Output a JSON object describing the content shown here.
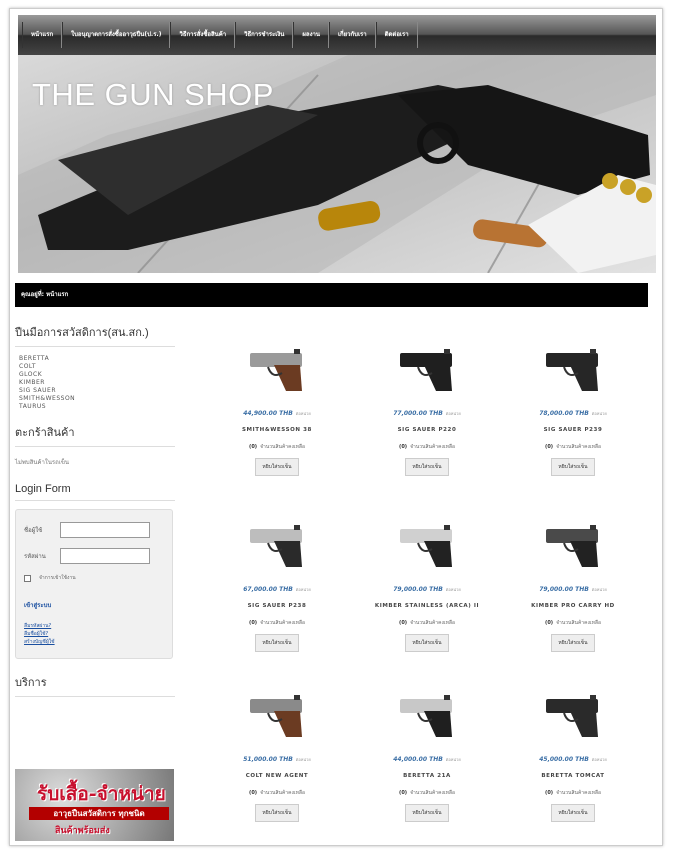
{
  "nav": {
    "items": [
      "หน้าแรก",
      "ใบอนุญาตการสั่งซื้ออาวุธปืน(ป.ร.)",
      "วิธีการสั่งซื้อสินค้า",
      "วิธีการชำระเงิน",
      "ผลงาน",
      "เกี่ยวกับเรา",
      "ติดต่อเรา"
    ]
  },
  "banner": {
    "title": "THE GUN SHOP"
  },
  "breadcrumb": {
    "text": "คุณอยู่ที่: หน้าแรก"
  },
  "sidebar": {
    "categories_title": "ปืนมือการสวัสดิการ(สน.สก.)",
    "categories": [
      "BERETTA",
      "COLT",
      "GLOCK",
      "KIMBER",
      "SIG SAUER",
      "SMITH&WESSON",
      "TAURUS"
    ],
    "cart_title": "ตะกร้าสินค้า",
    "cart_empty": "ไม่พบสินค้าในรถเข็น",
    "login_title": "Login Form",
    "username_label": "ชื่อผู้ใช้",
    "password_label": "รหัสผ่าน",
    "remember_label": "จำการเข้าใช้งาน",
    "login_button": "เข้าสู่ระบบ",
    "links": [
      "ลืมรหัสผ่าน?",
      "ลืมชื่อผู้ใช้?",
      "สร้างบัญชีผู้ใช้"
    ],
    "ad_title": "บริการ",
    "ad_text_1": "รับเสื้อ-จำหน่าย",
    "ad_text_2": "อาวุธปืนสวัสดิการ ทุกชนิด",
    "ad_text_3": "สินค้าพร้อมส่ง"
  },
  "products": [
    {
      "name": "SMITH&WESSON 38",
      "price": "44,900.00 THB",
      "unit": "ต่อหน่วย",
      "stock": "(0)",
      "stock_text": "จำนวนสินค้าคงเหลือ",
      "add_label": "หยิบใส่รถเข็น",
      "color": "#9a9a9a",
      "grip": "#6b3b22"
    },
    {
      "name": "SIG SAUER P220",
      "price": "77,000.00 THB",
      "unit": "ต่อหน่วย",
      "stock": "(0)",
      "stock_text": "จำนวนสินค้าคงเหลือ",
      "add_label": "หยิบใส่รถเข็น",
      "color": "#1f1f1f",
      "grip": "#1f1f1f"
    },
    {
      "name": "SIG SAUER P239",
      "price": "78,000.00 THB",
      "unit": "ต่อหน่วย",
      "stock": "(0)",
      "stock_text": "จำนวนสินค้าคงเหลือ",
      "add_label": "หยิบใส่รถเข็น",
      "color": "#262626",
      "grip": "#262626"
    },
    {
      "name": "SIG SAUER P238",
      "price": "67,000.00 THB",
      "unit": "ต่อหน่วย",
      "stock": "(0)",
      "stock_text": "จำนวนสินค้าคงเหลือ",
      "add_label": "หยิบใส่รถเข็น",
      "color": "#bdbdbd",
      "grip": "#2a2a2a"
    },
    {
      "name": "KIMBER STAINLESS (ARCA) II",
      "price": "79,000.00 THB",
      "unit": "ต่อหน่วย",
      "stock": "(0)",
      "stock_text": "จำนวนสินค้าคงเหลือ",
      "add_label": "หยิบใส่รถเข็น",
      "color": "#d0d0d0",
      "grip": "#222"
    },
    {
      "name": "KIMBER PRO CARRY HD",
      "price": "79,000.00 THB",
      "unit": "ต่อหน่วย",
      "stock": "(0)",
      "stock_text": "จำนวนสินค้าคงเหลือ",
      "add_label": "หยิบใส่รถเข็น",
      "color": "#4a4a4a",
      "grip": "#222"
    },
    {
      "name": "COLT NEW AGENT",
      "price": "51,000.00 THB",
      "unit": "ต่อหน่วย",
      "stock": "(0)",
      "stock_text": "จำนวนสินค้าคงเหลือ",
      "add_label": "หยิบใส่รถเข็น",
      "color": "#8a8a8a",
      "grip": "#6b3b22"
    },
    {
      "name": "BERETTA 21A",
      "price": "44,000.00 THB",
      "unit": "ต่อหน่วย",
      "stock": "(0)",
      "stock_text": "จำนวนสินค้าคงเหลือ",
      "add_label": "หยิบใส่รถเข็น",
      "color": "#c8c8c8",
      "grip": "#1f1f1f"
    },
    {
      "name": "BERETTA TOMCAT",
      "price": "45,000.00 THB",
      "unit": "ต่อหน่วย",
      "stock": "(0)",
      "stock_text": "จำนวนสินค้าคงเหลือ",
      "add_label": "หยิบใส่รถเข็น",
      "color": "#2a2a2a",
      "grip": "#2a2a2a"
    }
  ]
}
